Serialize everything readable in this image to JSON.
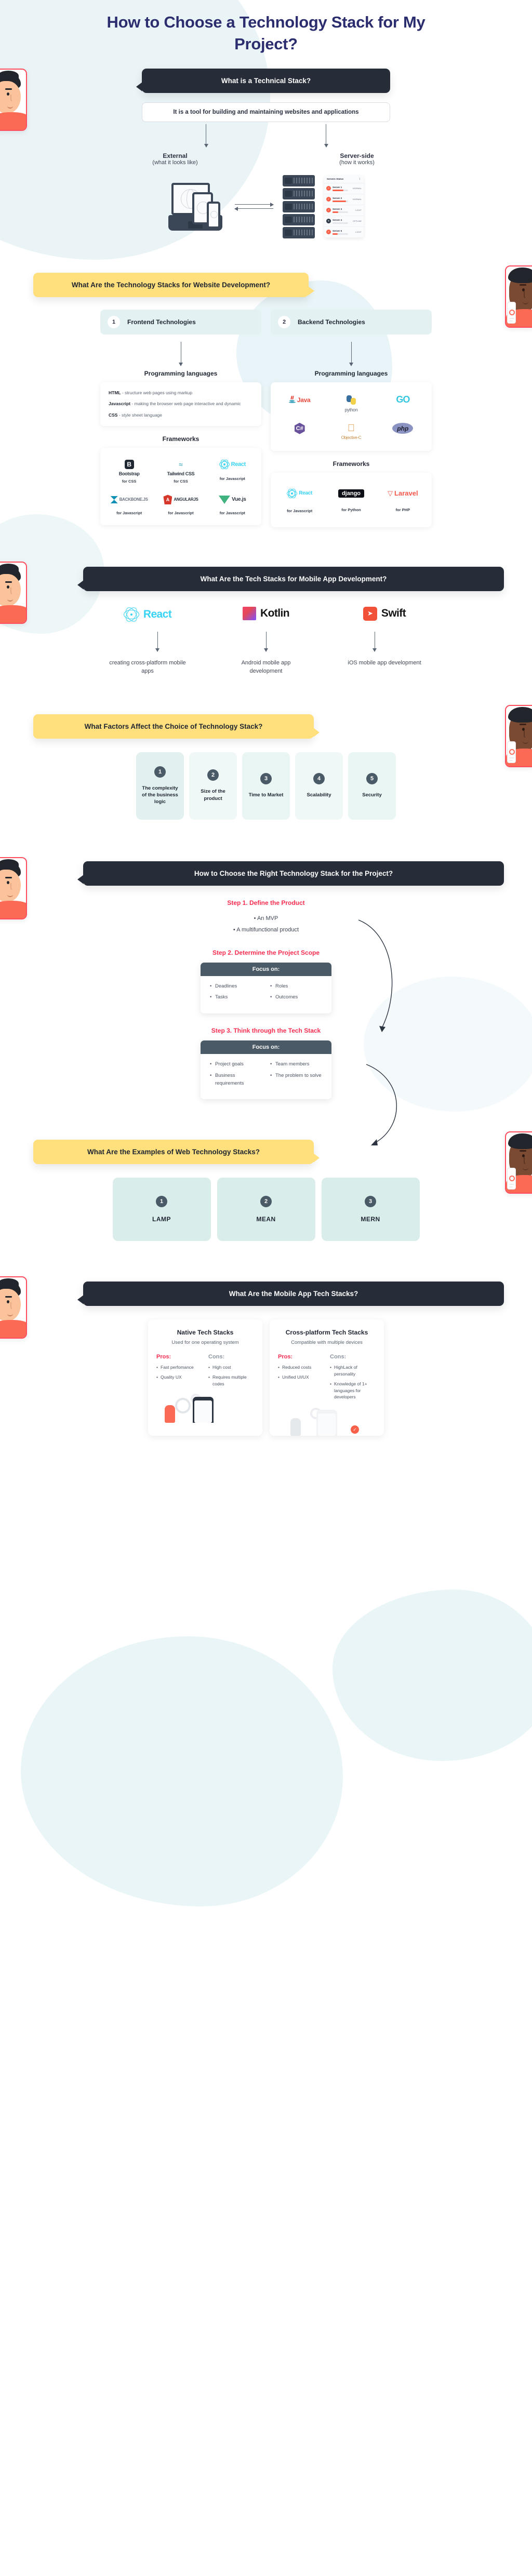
{
  "title": "How to Choose a Technology Stack for My Project?",
  "section1": {
    "question": "What is a Technical Stack?",
    "answer": "It is a tool for building and maintaining websites and applications",
    "left": {
      "heading": "External",
      "sub": "(what it looks like)"
    },
    "right": {
      "heading": "Server-side",
      "sub": "(how it works)"
    },
    "server_panel": {
      "panel_title": "Servers Status",
      "rows": [
        {
          "name": "Server 1",
          "status": "NORMAL",
          "level": 70
        },
        {
          "name": "Server 2",
          "status": "NORMAL",
          "level": 85
        },
        {
          "name": "Server 3",
          "status": "LIGHT",
          "level": 35
        },
        {
          "name": "Server 4",
          "status": "OFFLINE",
          "level": 0
        },
        {
          "name": "Server 5",
          "status": "LIGHT",
          "level": 33
        }
      ]
    }
  },
  "section2": {
    "question": "What Are the Technology Stacks for Website Development?",
    "frontend": {
      "num": "1",
      "label": "Frontend Technologies",
      "lang_heading": "Programming languages",
      "languages": [
        {
          "name": "HTML",
          "desc": " - structure web pages using markup"
        },
        {
          "name": "Javascript",
          "desc": " - making the browser web page interactive and dynamic"
        },
        {
          "name": "CSS",
          "desc": " - style sheet language"
        }
      ],
      "fw_heading": "Frameworks",
      "frameworks": [
        {
          "name": "Bootstrap",
          "caption": "for CSS"
        },
        {
          "name": "Tailwind CSS",
          "caption": "for CSS"
        },
        {
          "name": "React",
          "caption": "for Javascript"
        },
        {
          "name": "BACKBONE.JS",
          "caption": "for Javascript"
        },
        {
          "name": "ANGULARJS",
          "caption": "for Javascript"
        },
        {
          "name": "Vue.js",
          "caption": "for Javascript"
        }
      ]
    },
    "backend": {
      "num": "2",
      "label": "Backend Technologies",
      "lang_heading": "Programming languages",
      "languages": [
        {
          "name": "Java"
        },
        {
          "name": "python"
        },
        {
          "name": "GO"
        },
        {
          "name": "C#"
        },
        {
          "name": "Objective-C"
        },
        {
          "name": "php"
        }
      ],
      "fw_heading": "Frameworks",
      "frameworks": [
        {
          "name": "React",
          "caption": "for Javascript"
        },
        {
          "name": "django",
          "caption": "for Python"
        },
        {
          "name": "Laravel",
          "caption": "for PHP"
        }
      ]
    }
  },
  "section3": {
    "question": "What Are the Tech Stacks for Mobile App Development?",
    "items": [
      {
        "name": "React",
        "caption": "creating cross-platform mobile apps"
      },
      {
        "name": "Kotlin",
        "caption": "Android mobile app development"
      },
      {
        "name": "Swift",
        "caption": "iOS mobile app development"
      }
    ]
  },
  "section4": {
    "question": "What Factors Affect the Choice of Technology Stack?",
    "factors": [
      {
        "num": "1",
        "label": "The complexity of the business logic"
      },
      {
        "num": "2",
        "label": "Size of the product"
      },
      {
        "num": "3",
        "label": "Time to Market"
      },
      {
        "num": "4",
        "label": "Scalability"
      },
      {
        "num": "5",
        "label": "Security"
      }
    ]
  },
  "section5": {
    "question": "How to Choose the Right Technology Stack for the Project?",
    "step1": {
      "title": "Step 1. Define the Product",
      "bullets": [
        "An MVP",
        "A multifunctional product"
      ]
    },
    "step2": {
      "title": "Step 2. Determine the Project Scope",
      "focus_label": "Focus on:",
      "left": [
        "Deadlines",
        "Tasks"
      ],
      "right": [
        "Roles",
        "Outcomes"
      ]
    },
    "step3": {
      "title": "Step 3. Think through the Tech Stack",
      "focus_label": "Focus on:",
      "left": [
        "Project goals",
        "Business requirements"
      ],
      "right": [
        "Team members",
        "The problem to solve"
      ]
    }
  },
  "section6": {
    "question": "What Are the Examples of Web Technology Stacks?",
    "examples": [
      {
        "num": "1",
        "label": "LAMP"
      },
      {
        "num": "2",
        "label": "MEAN"
      },
      {
        "num": "3",
        "label": "MERN"
      }
    ]
  },
  "section7": {
    "question": "What Are the Mobile App Tech Stacks?",
    "cards": [
      {
        "title": "Native Tech Stacks",
        "subtitle": "Used for one operating system",
        "pros_label": "Pros:",
        "cons_label": "Cons:",
        "pros": [
          "Fast perfomance",
          "Quality UX"
        ],
        "cons": [
          "High cost",
          "Requires multiple codes"
        ]
      },
      {
        "title": "Cross-platform Tech Stacks",
        "subtitle": "Compatible with multiple devices",
        "pros_label": "Pros:",
        "cons_label": "Cons:",
        "pros": [
          "Reduced costs",
          "Unified UI/UX"
        ],
        "cons": [
          "HighLack of personality",
          "Knowledge of 1+ languages for developers"
        ]
      }
    ]
  },
  "colors": {
    "title": "#2b2d6e",
    "dark_bubble": "#262d38",
    "yellow_bubble": "#ffe07d",
    "accent_red": "#f72c4f",
    "mint": "#e2f1ef",
    "slate": "#4a5a66"
  }
}
